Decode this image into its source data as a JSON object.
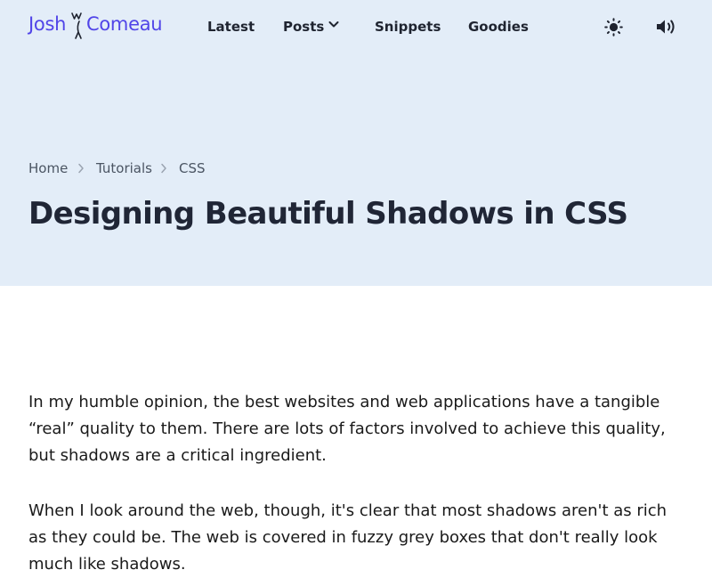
{
  "logo": {
    "first": "Josh",
    "last": "Comeau"
  },
  "nav": {
    "items": [
      {
        "label": "Latest"
      },
      {
        "label": "Posts"
      },
      {
        "label": "Snippets"
      },
      {
        "label": "Goodies"
      }
    ],
    "icons": {
      "posts_dropdown": "chevron-down-icon",
      "theme_toggle": "sun-icon",
      "sound_toggle": "speaker-icon"
    }
  },
  "breadcrumb": {
    "items": [
      "Home",
      "Tutorials",
      "CSS"
    ],
    "separator_icon": "chevron-right-icon"
  },
  "article": {
    "title": "Designing Beautiful Shadows in CSS",
    "paragraphs": [
      "In my humble opinion, the best websites and web applications have a tangible “real” quality to them. There are lots of factors involved to achieve this quality, but shadows are a critical ingredient.",
      "When I look around the web, though, it's clear that most shadows aren't as rich as they could be. The web is covered in fuzzy grey boxes that don't really look much like shadows."
    ]
  },
  "colors": {
    "hero_bg": "#e3edf8",
    "brand": "#5145e8",
    "text": "#1f2430"
  }
}
